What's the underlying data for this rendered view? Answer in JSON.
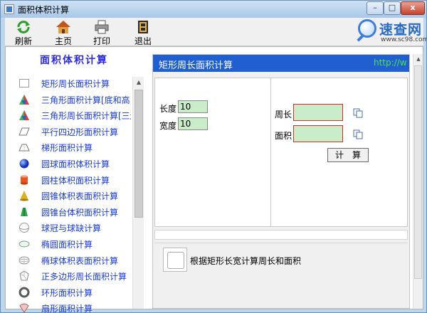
{
  "window": {
    "title": "面积体积计算",
    "min_label": "–",
    "max_label": "□",
    "close_label": "x"
  },
  "toolbar": {
    "refresh": "刷新",
    "home": "主页",
    "print": "打印",
    "exit": "退出"
  },
  "logo": {
    "name": "速查网",
    "url": "www.sc98.com",
    "color": "#2a6bc6"
  },
  "sidebar": {
    "title": "面积体积计算",
    "items": [
      {
        "label": "矩形周长面积计算",
        "icon": "rectangle-icon"
      },
      {
        "label": "三角形面积计算[底和高]",
        "icon": "triangle-icon"
      },
      {
        "label": "三角形周长面积计算[三边]",
        "icon": "triangle-icon"
      },
      {
        "label": "平行四边形面积计算",
        "icon": "parallelogram-icon"
      },
      {
        "label": "梯形面积计算",
        "icon": "trapezoid-icon"
      },
      {
        "label": "圆球面积体积计算",
        "icon": "sphere-icon"
      },
      {
        "label": "圆柱体积面积计算",
        "icon": "cylinder-icon"
      },
      {
        "label": "圆锥体积表面积计算",
        "icon": "cone-icon"
      },
      {
        "label": "圆锥台体积面积计算",
        "icon": "frustum-icon"
      },
      {
        "label": "球冠与球缺计算",
        "icon": "spherical-cap-icon"
      },
      {
        "label": "椭圆面积计算",
        "icon": "ellipse-icon"
      },
      {
        "label": "椭球体积表面积计算",
        "icon": "ellipsoid-icon"
      },
      {
        "label": "正多边形周长面积计算",
        "icon": "polygon-icon"
      },
      {
        "label": "环形面积计算",
        "icon": "ring-icon"
      },
      {
        "label": "扇形面积计算",
        "icon": "sector-icon"
      }
    ]
  },
  "panel": {
    "title": "矩形周长面积计算",
    "url": "http://w",
    "length_label": "长度",
    "length_value": "10",
    "width_label": "宽度",
    "width_value": "10",
    "perimeter_label": "周长",
    "perimeter_value": "",
    "area_label": "面积",
    "area_value": "",
    "calc_button": "计　算",
    "description": "根据矩形长宽计算周长和面积"
  },
  "colors": {
    "header_blue": "#1f5fd0",
    "url_green": "#4fe34f",
    "link_blue": "#1a3bd6",
    "input_green": "#c9ecc9",
    "output_border": "#d12c2c"
  }
}
